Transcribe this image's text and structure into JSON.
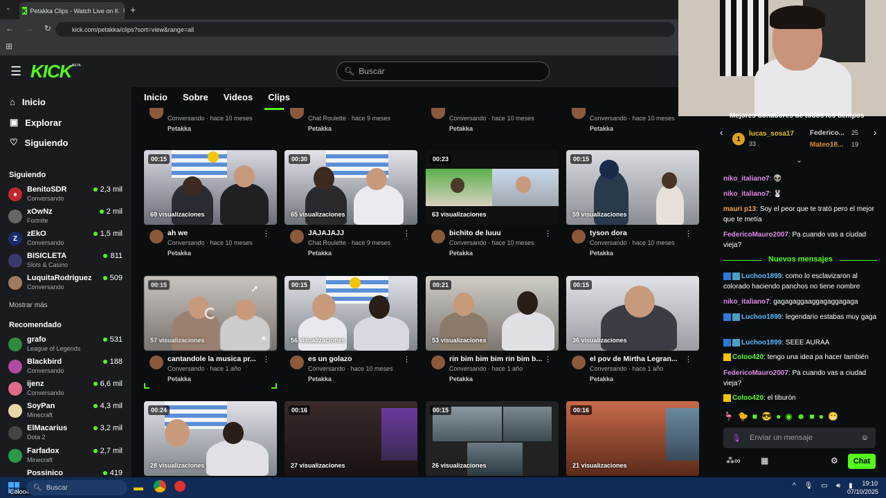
{
  "browser": {
    "tab_title": "Petakka Clips - Watch Live on K",
    "url": "kick.com/petakka/clips?sort=view&range=all"
  },
  "header": {
    "logo": "KICK",
    "beta": "BETA",
    "search_placeholder": "Buscar"
  },
  "sidebar": {
    "nav": [
      {
        "label": "Inicio",
        "icon": "home-icon"
      },
      {
        "label": "Explorar",
        "icon": "compass-icon"
      },
      {
        "label": "Siguiendo",
        "icon": "heart-icon"
      }
    ],
    "following_title": "Siguiendo",
    "following": [
      {
        "name": "BenitoSDR",
        "category": "Conversando",
        "viewers": "2,3 mil"
      },
      {
        "name": "xOwNz",
        "category": "Fortnite",
        "viewers": "2 mil"
      },
      {
        "name": "zEkO",
        "category": "Conversando",
        "viewers": "1,5 mil"
      },
      {
        "name": "BISICLETA",
        "category": "Slots & Casino",
        "viewers": "811"
      },
      {
        "name": "LuquitaRodriguez",
        "category": "Conversando",
        "viewers": "509"
      }
    ],
    "show_more": "Mostrar más",
    "recommended_title": "Recomendado",
    "recommended": [
      {
        "name": "grafo",
        "category": "League of Legends",
        "viewers": "531"
      },
      {
        "name": "Blackbird",
        "category": "Conversando",
        "viewers": "188"
      },
      {
        "name": "ijenz",
        "category": "Conversando",
        "viewers": "6,6 mil"
      },
      {
        "name": "SoyPan",
        "category": "Minecraft",
        "viewers": "4,3 mil"
      },
      {
        "name": "ElMacarius",
        "category": "Dota 2",
        "viewers": "3,2 mil"
      },
      {
        "name": "Farfadox",
        "category": "Minecraft",
        "viewers": "2,7 mil"
      },
      {
        "name": "Possinico",
        "category": "",
        "viewers": "419"
      }
    ]
  },
  "tabs": [
    "Inicio",
    "Sobre",
    "Videos",
    "Clips"
  ],
  "partial_row": [
    {
      "meta": "Conversando · hace 10 meses",
      "author": "Petakka"
    },
    {
      "meta": "Chat Roulette · hace 9 meses",
      "author": "Petakka"
    },
    {
      "meta": "Conversando · hace 10 meses",
      "author": "Petakka"
    },
    {
      "meta": "Conversando · hace 10 meses",
      "author": "Petakka"
    }
  ],
  "clips": [
    {
      "duration": "00:15",
      "views": "69 visualizaciones",
      "title": "ah we",
      "meta": "Conversando · hace 10 meses",
      "author": "Petakka"
    },
    {
      "duration": "00:30",
      "views": "65 visualizaciones",
      "title": "JAJAJAJJ",
      "meta": "Chat Roulette · hace 9 meses",
      "author": "Petakka"
    },
    {
      "duration": "00:23",
      "views": "63 visualizaciones",
      "title": "bichito de luuu",
      "meta": "Conversando · hace 10 meses",
      "author": "Petakka"
    },
    {
      "duration": "00:15",
      "views": "59 visualizaciones",
      "title": "tyson dora",
      "meta": "Conversando · hace 10 meses",
      "author": "Petakka"
    },
    {
      "duration": "00:15",
      "views": "57 visualizaciones",
      "title": "cantandole la musica pr...",
      "meta": "Conversando · hace 1 año",
      "author": "Petakka"
    },
    {
      "duration": "00:15",
      "views": "56 visualizaciones",
      "title": "es un golazo",
      "meta": "Conversando · hace 10 meses",
      "author": "Petakka"
    },
    {
      "duration": "00:21",
      "views": "53 visualizaciones",
      "title": "rin bim bim bim rin bim b...",
      "meta": "Conversando · hace 1 año",
      "author": "Petakka"
    },
    {
      "duration": "00:15",
      "views": "36 visualizaciones",
      "title": "el pov de Mirtha Legran...",
      "meta": "Conversando · hace 1 año",
      "author": "Petakka"
    },
    {
      "duration": "00:24",
      "views": "28 visualizaciones",
      "title": "",
      "meta": "",
      "author": ""
    },
    {
      "duration": "00:16",
      "views": "27 visualizaciones",
      "title": "",
      "meta": "",
      "author": ""
    },
    {
      "duration": "00:15",
      "views": "26 visualizaciones",
      "title": "",
      "meta": "",
      "author": ""
    },
    {
      "duration": "00:16",
      "views": "21 visualizaciones",
      "title": "",
      "meta": "",
      "author": ""
    }
  ],
  "chat": {
    "top_donors_title": "Mejores donadores de todos los tiempos",
    "donors": [
      {
        "name": "lucas_sosa17",
        "amount": "33"
      },
      {
        "name": "Federico...",
        "amount": "25"
      },
      {
        "name": "Mateo18...",
        "amount": "19"
      }
    ],
    "messages_before": [
      {
        "user": "niko_italiano7",
        "text": ""
      },
      {
        "user": "niko_italiano7",
        "text": ""
      },
      {
        "user": "mauri p13",
        "text": "Soy el peor que te trató pero el mejor que te metía"
      },
      {
        "user": "FedericoMauro2007",
        "text": "Pa cuando vas a ciudad vieja?"
      }
    ],
    "new_messages_label": "Nuevos mensajes",
    "messages_after": [
      {
        "user": "Luchoo1899",
        "text": "como lo esclavizaron al colorado haciendo panchos no tiene nombre"
      },
      {
        "user": "niko_italiano7",
        "text": "gagagaggaaggagaggagaga"
      },
      {
        "user": "Luchoo1899",
        "text": "legendario estabas muy gaga"
      },
      {
        "user": "Luchoo1899",
        "text": "SEEE AURAA"
      },
      {
        "user": "Coloo420",
        "text": "tengo una idea pa hacer también"
      },
      {
        "user": "FedericoMauro2007",
        "text": "Pa cuando vas a ciudad vieja?"
      },
      {
        "user": "Coloo420",
        "text": "el tiburón"
      }
    ],
    "input_placeholder": "Enviar un mensaje",
    "send_label": "Chat"
  },
  "taskbar": {
    "search": "Buscar",
    "toast": "Coloo420: el tiburón",
    "time": "19:10",
    "date": "07/10/2025"
  },
  "colors": {
    "accent": "#53fc18",
    "bg": "#0b0e0f",
    "panel": "#191b1f"
  }
}
